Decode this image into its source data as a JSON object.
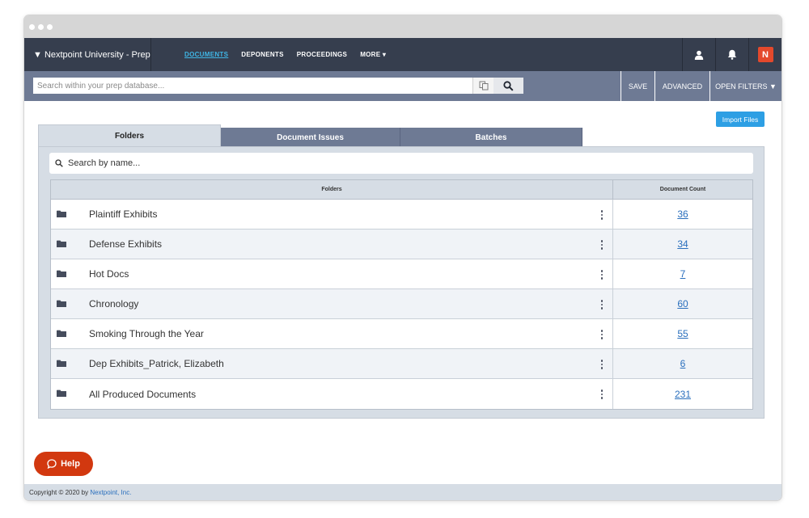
{
  "nav": {
    "brand": "▼ Nextpoint University - Prep",
    "links": [
      "DOCUMENTS",
      "DEPONENTS",
      "PROCEEDINGS",
      "MORE ▾"
    ],
    "logo_text": "N",
    "icons": [
      "user-icon",
      "bell-icon",
      "nextpoint-logo-icon"
    ]
  },
  "search": {
    "placeholder": "Search within your prep database...",
    "buttons": [
      "SAVE",
      "ADVANCED",
      "OPEN FILTERS ▼"
    ]
  },
  "import_button": "Import Files",
  "tabs": [
    "Folders",
    "Document Issues",
    "Batches"
  ],
  "name_search": {
    "placeholder": "Search by name..."
  },
  "table": {
    "headers": {
      "folders": "Folders",
      "count": "Document Count"
    },
    "rows": [
      {
        "name": "Plaintiff Exhibits",
        "count": "36"
      },
      {
        "name": "Defense Exhibits",
        "count": "34"
      },
      {
        "name": "Hot Docs",
        "count": "7"
      },
      {
        "name": "Chronology",
        "count": "60"
      },
      {
        "name": "Smoking Through the Year",
        "count": "55"
      },
      {
        "name": "Dep Exhibits_Patrick, Elizabeth",
        "count": "6"
      },
      {
        "name": "All Produced Documents",
        "count": "231"
      }
    ]
  },
  "help": "Help",
  "footer": {
    "prefix": "Copyright ©",
    "year": "2020",
    "by": "by",
    "company": "Nextpoint, Inc."
  },
  "colors": {
    "nav_bg": "#363e4e",
    "searchbar_bg": "#6e7a94",
    "accent": "#3fb6e6",
    "help": "#d2380f",
    "link": "#2a6fbd",
    "import": "#2d9fe4"
  }
}
